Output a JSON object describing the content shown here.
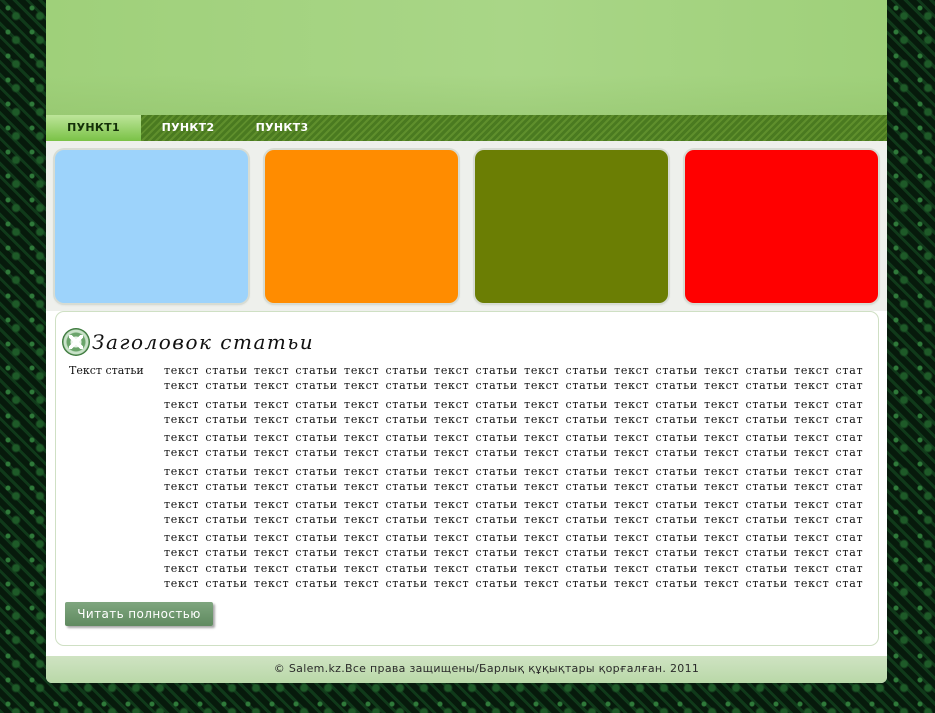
{
  "nav": {
    "items": [
      {
        "label": "ПУНКТ1",
        "active": true
      },
      {
        "label": "ПУНКТ2",
        "active": false
      },
      {
        "label": "ПУНКТ3",
        "active": false
      }
    ]
  },
  "tiles": [
    {
      "color": "#9dd3fb"
    },
    {
      "color": "#ff8c00"
    },
    {
      "color": "#6b7e04"
    },
    {
      "color": "#ff0000"
    }
  ],
  "article": {
    "title": "Заголовок  статьи",
    "lead": "Текст статьи",
    "lines": [
      "текст статьи текст статьи текст статьи текст статьи  текст статьи текст статьи текст статьи текст стат",
      "текст статьи текст статьи текст статьи текст статьи  текст статьи текст статьи текст статьи текст стат",
      "текст статьи текст статьи текст статьи текст статьи  текст статьи текст статьи текст статьи текст стат",
      "текст статьи текст статьи текст статьи текст статьи  текст статьи текст статьи текст статьи текст стат",
      "текст статьи текст статьи текст статьи текст статьи  текст статьи текст статьи текст статьи текст стат",
      "текст статьи текст статьи текст статьи текст статьи  текст статьи текст статьи текст статьи текст стат",
      "текст статьи текст статьи текст статьи текст статьи  текст статьи текст статьи текст статьи текст стат",
      "текст статьи текст статьи текст статьи текст статьи  текст статьи текст статьи текст статьи текст стат",
      "текст статьи текст статьи текст статьи текст статьи  текст статьи текст статьи текст статьи текст стат",
      "текст статьи текст статьи текст статьи текст статьи  текст статьи текст статьи текст статьи текст стат",
      "текст статьи текст статьи текст статьи текст статьи  текст статьи текст статьи текст статьи текст стат",
      "текст статьи текст статьи текст статьи текст статьи  текст статьи текст статьи текст статьи текст стат",
      "текст статьи текст статьи текст статьи текст статьи  текст статьи текст статьи текст статьи текст стат",
      "текст статьи текст статьи текст статьи текст статьи  текст статьи текст статьи текст статьи текст стат"
    ],
    "read_more": "Читать полностью",
    "icon": "clover-emblem-icon"
  },
  "footer": {
    "text": "© Salem.kz.Все права защищены/Барлық құқықтары қорғалған. 2011"
  }
}
